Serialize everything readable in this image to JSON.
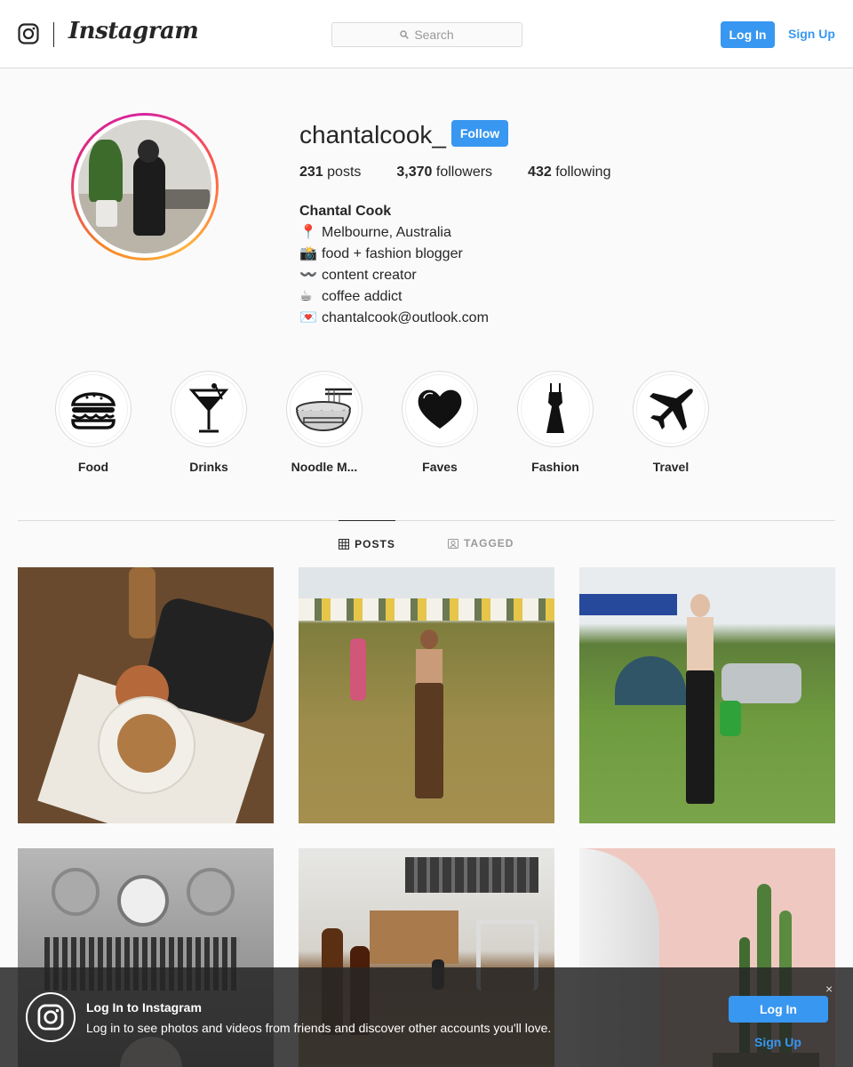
{
  "header": {
    "wordmark": "Instagram",
    "search_placeholder": "Search",
    "login_label": "Log In",
    "signup_label": "Sign Up"
  },
  "profile": {
    "username": "chantalcook_",
    "follow_label": "Follow",
    "stats": {
      "posts_count": "231",
      "posts_label": "posts",
      "followers_count": "3,370",
      "followers_label": "followers",
      "following_count": "432",
      "following_label": "following"
    },
    "bio": {
      "name": "Chantal Cook",
      "lines": [
        {
          "emoji": "📍",
          "text": "Melbourne, Australia"
        },
        {
          "emoji": "📸",
          "text": "food + fashion blogger"
        },
        {
          "emoji": "〰️",
          "text": "content creator"
        },
        {
          "emoji": "☕",
          "text": "coffee addict"
        },
        {
          "emoji": "💌",
          "text": "chantalcook@outlook.com"
        }
      ]
    }
  },
  "highlights": [
    {
      "label": "Food",
      "icon": "burger-icon"
    },
    {
      "label": "Drinks",
      "icon": "cocktail-icon"
    },
    {
      "label": "Noodle M...",
      "icon": "noodle-bowl-icon"
    },
    {
      "label": "Faves",
      "icon": "heart-icon"
    },
    {
      "label": "Fashion",
      "icon": "dress-icon"
    },
    {
      "label": "Travel",
      "icon": "airplane-icon"
    }
  ],
  "tabs": {
    "posts_label": "POSTS",
    "tagged_label": "TAGGED",
    "active": "POSTS"
  },
  "banner": {
    "title": "Log In to Instagram",
    "subtitle": "Log in to see photos and videos from friends and discover other accounts you'll love.",
    "login_label": "Log In",
    "signup_label": "Sign Up",
    "close_glyph": "×"
  },
  "colors": {
    "accent": "#3897f0",
    "text": "#262626",
    "border": "#dbdbdb",
    "background": "#fafafa"
  }
}
